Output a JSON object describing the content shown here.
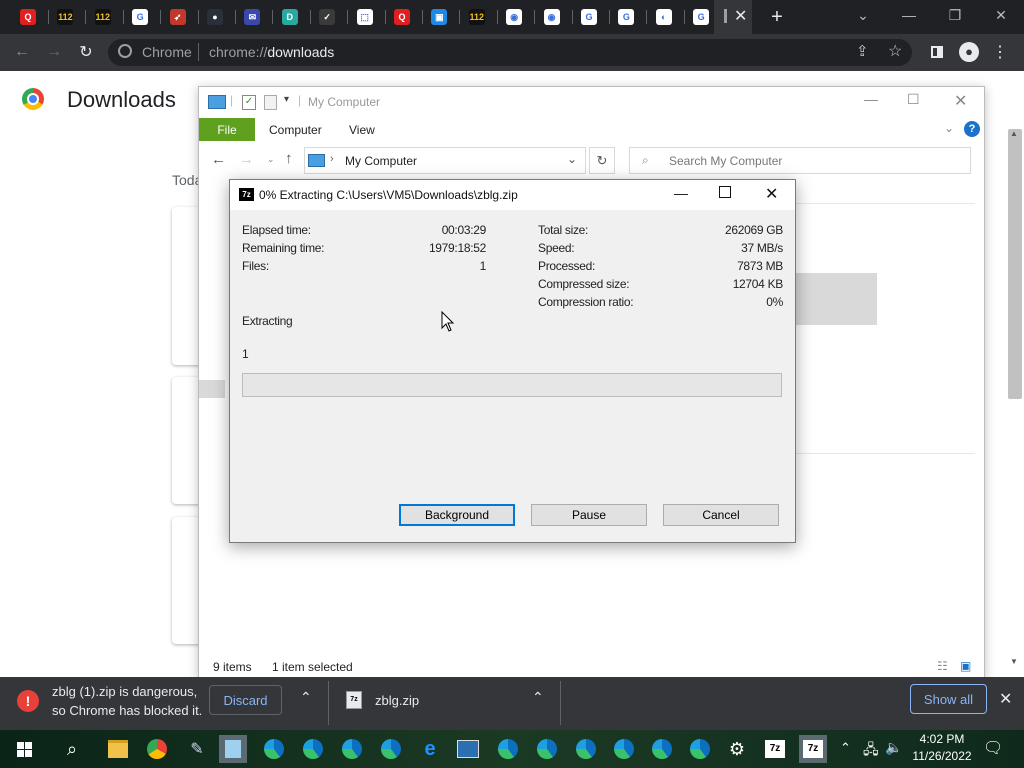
{
  "browser": {
    "tab_favicons": [
      {
        "name": "opera-icon",
        "color": "#e02020",
        "glyph": "Q"
      },
      {
        "name": "ch112-icon",
        "color": "#111111",
        "glyph": "112"
      },
      {
        "name": "ch112-icon",
        "color": "#111111",
        "glyph": "112"
      },
      {
        "name": "google-icon",
        "color": "#ffffff",
        "glyph": "G"
      },
      {
        "name": "bird-icon",
        "color": "#c0392b",
        "glyph": "➶"
      },
      {
        "name": "dark-app-icon",
        "color": "#2a2f3a",
        "glyph": "●"
      },
      {
        "name": "mail-icon",
        "color": "#3949ab",
        "glyph": "✉"
      },
      {
        "name": "d-logo-icon",
        "color": "#2aa8a0",
        "glyph": "D"
      },
      {
        "name": "check-icon",
        "color": "#3a3a3a",
        "glyph": "✓"
      },
      {
        "name": "lock-app-icon",
        "color": "#ffffff",
        "glyph": "⬚"
      },
      {
        "name": "opera-icon",
        "color": "#e02020",
        "glyph": "Q"
      },
      {
        "name": "blue-app-icon",
        "color": "#1e88e5",
        "glyph": "▣"
      },
      {
        "name": "ch112-icon",
        "color": "#111111",
        "glyph": "112"
      },
      {
        "name": "chrome-icon",
        "color": "#ffffff",
        "glyph": "◉"
      },
      {
        "name": "chrome-icon",
        "color": "#ffffff",
        "glyph": "◉"
      },
      {
        "name": "google-icon",
        "color": "#ffffff",
        "glyph": "G"
      },
      {
        "name": "google-icon",
        "color": "#ffffff",
        "glyph": "G"
      },
      {
        "name": "globe-icon",
        "color": "#ffffff",
        "glyph": "◐"
      },
      {
        "name": "google-icon",
        "color": "#ffffff",
        "glyph": "G"
      }
    ],
    "omnibox": {
      "site_label": "Chrome",
      "url_prefix": "chrome://",
      "url_path": "downloads"
    },
    "page_title": "Downloads",
    "today_label": "Toda"
  },
  "explorer": {
    "title": "My Computer",
    "ribbon_tabs": [
      "File",
      "Computer",
      "View"
    ],
    "address": "My Computer",
    "search_placeholder": "Search My Computer",
    "status_items": "9 items",
    "status_selected": "1 item selected"
  },
  "extract_dialog": {
    "title": "0% Extracting C:\\Users\\VM5\\Downloads\\zblg.zip",
    "left_stats": [
      {
        "label": "Elapsed time:",
        "value": "00:03:29"
      },
      {
        "label": "Remaining time:",
        "value": "1979:18:52"
      },
      {
        "label": "Files:",
        "value": "1"
      }
    ],
    "right_stats": [
      {
        "label": "Total size:",
        "value": "262069 GB"
      },
      {
        "label": "Speed:",
        "value": "37 MB/s"
      },
      {
        "label": "Processed:",
        "value": "7873 MB"
      },
      {
        "label": "Compressed size:",
        "value": "12704 KB"
      },
      {
        "label": "Compression ratio:",
        "value": "0%"
      }
    ],
    "status": "Extracting",
    "current_item": "1",
    "progress": 0,
    "buttons": {
      "background": "Background",
      "pause": "Pause",
      "cancel": "Cancel"
    }
  },
  "download_shelf": {
    "warning_line1": "zblg (1).zip is dangerous,",
    "warning_line2": "so Chrome has blocked it.",
    "discard": "Discard",
    "item_name": "zblg.zip",
    "show_all": "Show all"
  },
  "taskbar": {
    "time": "4:02 PM",
    "date": "11/26/2022"
  },
  "colors": {
    "file_tab": "#5fa01f",
    "help": "#1a73c8",
    "warning_red": "#e8413a",
    "show_all_border": "#8ab4f8"
  }
}
